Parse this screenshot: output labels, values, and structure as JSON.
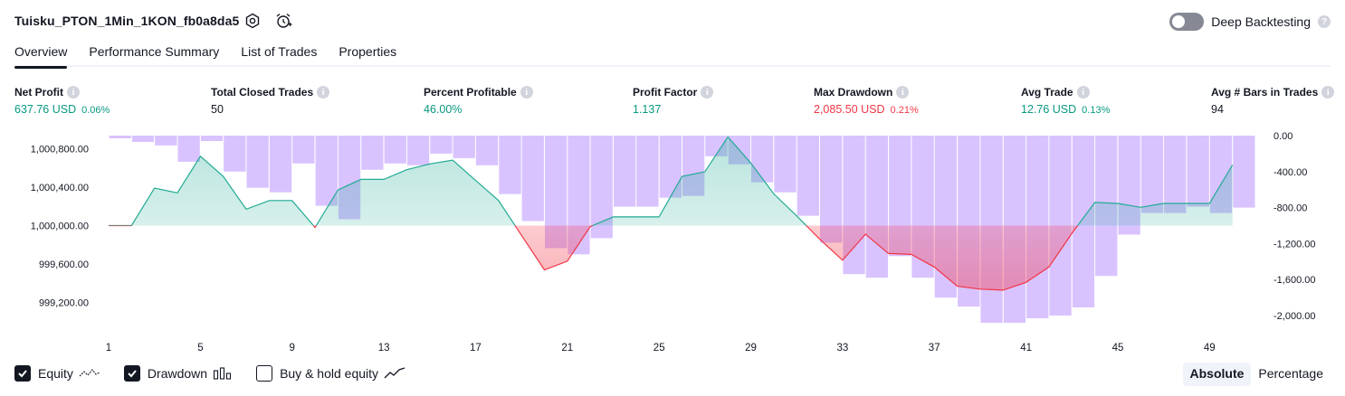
{
  "header": {
    "title": "Tuisku_PTON_1Min_1KON_fb0a8da5",
    "deep_backtesting_label": "Deep Backtesting",
    "help_glyph": "?"
  },
  "tabs": [
    {
      "label": "Overview",
      "active": true
    },
    {
      "label": "Performance Summary",
      "active": false
    },
    {
      "label": "List of Trades",
      "active": false
    },
    {
      "label": "Properties",
      "active": false
    }
  ],
  "metrics": [
    {
      "label": "Net Profit",
      "value": "637.76 USD",
      "pct": "0.06%",
      "color": "green"
    },
    {
      "label": "Total Closed Trades",
      "value": "50",
      "pct": "",
      "color": "dark"
    },
    {
      "label": "Percent Profitable",
      "value": "46.00%",
      "pct": "",
      "color": "green"
    },
    {
      "label": "Profit Factor",
      "value": "1.137",
      "pct": "",
      "color": "green"
    },
    {
      "label": "Max Drawdown",
      "value": "2,085.50 USD",
      "pct": "0.21%",
      "color": "red"
    },
    {
      "label": "Avg Trade",
      "value": "12.76 USD",
      "pct": "0.13%",
      "color": "green"
    },
    {
      "label": "Avg # Bars in Trades",
      "value": "94",
      "pct": "",
      "color": "dark"
    }
  ],
  "chart_data": {
    "type": "line",
    "equity_axis": {
      "ticks": [
        "1,000,800.00",
        "1,000,400.00",
        "1,000,000.00",
        "999,600.00",
        "999,200.00"
      ],
      "values": [
        1000800,
        1000400,
        1000000,
        999600,
        999200
      ]
    },
    "drawdown_axis": {
      "ticks": [
        "0.00",
        "-400.00",
        "-800.00",
        "-1,200.00",
        "-1,600.00",
        "-2,000.00"
      ],
      "values": [
        0,
        -400,
        -800,
        -1200,
        -1600,
        -2000
      ]
    },
    "x_ticks": [
      "1",
      "5",
      "9",
      "13",
      "17",
      "21",
      "25",
      "29",
      "33",
      "37",
      "41",
      "45",
      "49"
    ],
    "equity_baseline": 1000000,
    "series": [
      {
        "name": "Equity",
        "color": "#22ab94",
        "values": [
          1000000,
          1000000,
          1000390,
          1000340,
          1000720,
          1000510,
          1000170,
          1000260,
          1000260,
          999980,
          1000370,
          1000480,
          1000480,
          1000580,
          1000640,
          1000680,
          1000470,
          1000260,
          999900,
          999540,
          999630,
          999990,
          1000090,
          1000090,
          1000090,
          1000510,
          1000560,
          1000920,
          1000650,
          1000330,
          1000100,
          999860,
          999640,
          999910,
          999710,
          999700,
          999570,
          999370,
          999340,
          999330,
          999410,
          999570,
          999920,
          1000240,
          1000230,
          1000190,
          1000230,
          1000230,
          1000230,
          1000630
        ]
      },
      {
        "name": "Drawdown",
        "color": "#b388ff",
        "values": [
          -30,
          -70,
          -110,
          -290,
          -60,
          -400,
          -580,
          -630,
          -310,
          -780,
          -930,
          -380,
          -310,
          -330,
          -200,
          -250,
          -330,
          -650,
          -950,
          -1250,
          -1320,
          -1140,
          -790,
          -790,
          -690,
          -670,
          -230,
          -320,
          -520,
          -630,
          -890,
          -1190,
          -1540,
          -1580,
          -1340,
          -1580,
          -1800,
          -1900,
          -2080,
          -2080,
          -2030,
          -2000,
          -1910,
          -1560,
          -1100,
          -860,
          -860,
          -790,
          -860,
          -800
        ]
      }
    ]
  },
  "legend": [
    {
      "label": "Equity",
      "checked": true,
      "icon": "equity-line-icon"
    },
    {
      "label": "Drawdown",
      "checked": true,
      "icon": "drawdown-bars-icon"
    },
    {
      "label": "Buy & hold equity",
      "checked": false,
      "icon": "buy-hold-line-icon"
    }
  ],
  "scale_toggle": {
    "absolute": "Absolute",
    "percentage": "Percentage",
    "active": "absolute"
  }
}
